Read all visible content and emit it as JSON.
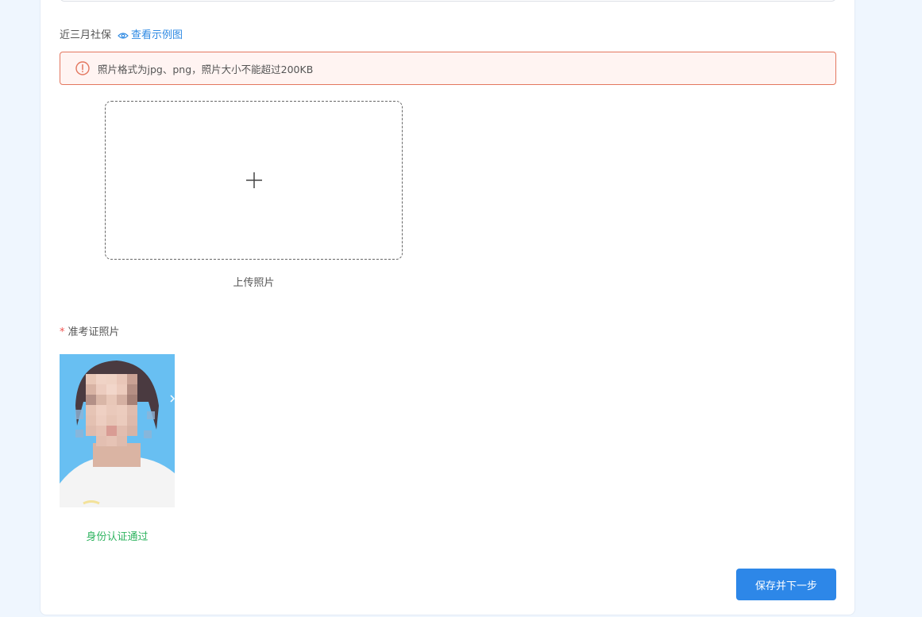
{
  "social_security": {
    "label": "近三月社保",
    "example_link": "查看示例图"
  },
  "alert": {
    "message": "照片格式为jpg、png，照片大小不能超过200KB",
    "icon": "exclamation-circle-icon",
    "color": "#e3775f"
  },
  "upload": {
    "icon": "plus-icon",
    "caption": "上传照片"
  },
  "exam_photo": {
    "required_mark": "*",
    "label": "准考证照片",
    "status": "身份认证通过",
    "status_color": "#2eb35f"
  },
  "actions": {
    "submit_label": "保存并下一步",
    "accent": "#2d87e8"
  }
}
